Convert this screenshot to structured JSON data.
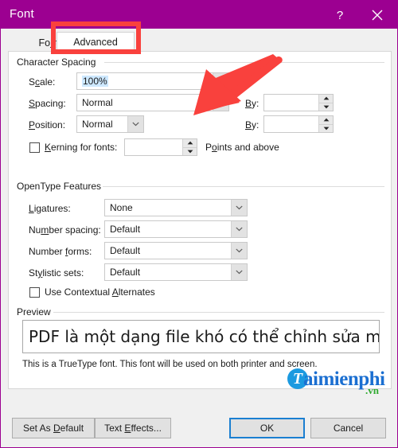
{
  "window": {
    "title": "Font",
    "help_glyph": "?",
    "close_glyph": "✕",
    "titlebar_color": "#9c0091"
  },
  "tabs": [
    {
      "label": "Font",
      "accel": "n",
      "active": false
    },
    {
      "label": "Advanced",
      "accel": "",
      "active": true
    }
  ],
  "character_spacing": {
    "group_label": "Character Spacing",
    "scale": {
      "label": "Scale:",
      "value": "100%",
      "selected": true
    },
    "spacing": {
      "label": "Spacing:",
      "value": "Normal",
      "by_label": "By:",
      "by_value": ""
    },
    "position": {
      "label": "Position:",
      "value": "Normal",
      "by_label": "By:",
      "by_value": ""
    },
    "kerning": {
      "label": "Kerning for fonts:",
      "checked": false,
      "value": "",
      "suffix": "Points and above"
    }
  },
  "opentype_features": {
    "group_label": "OpenType Features",
    "rows": [
      {
        "label": "Ligatures:",
        "value": "None"
      },
      {
        "label": "Number spacing:",
        "value": "Default"
      },
      {
        "label": "Number forms:",
        "value": "Default"
      },
      {
        "label": "Stylistic sets:",
        "value": "Default"
      }
    ],
    "contextual_alternates": {
      "label": "Use Contextual Alternates",
      "checked": false
    }
  },
  "preview": {
    "group_label": "Preview",
    "sample_text": "PDF là một dạng file khó có thể chỉnh sửa một cách t",
    "note": "This is a TrueType font. This font will be used on both printer and screen."
  },
  "footer": {
    "set_as_default": "Set As Default",
    "text_effects": "Text Effects...",
    "ok": "OK",
    "cancel": "Cancel"
  },
  "annotations": {
    "highlight_color": "#f9413d",
    "arrow_color": "#f9413d",
    "target": "Advanced"
  },
  "watermark": {
    "logo_letter": "T",
    "brand": "aimienphi",
    "tld": ".vn",
    "brand_color": "#1b6fd1",
    "logo_color": "#1b9ae0",
    "tld_color": "#2faa2f"
  }
}
